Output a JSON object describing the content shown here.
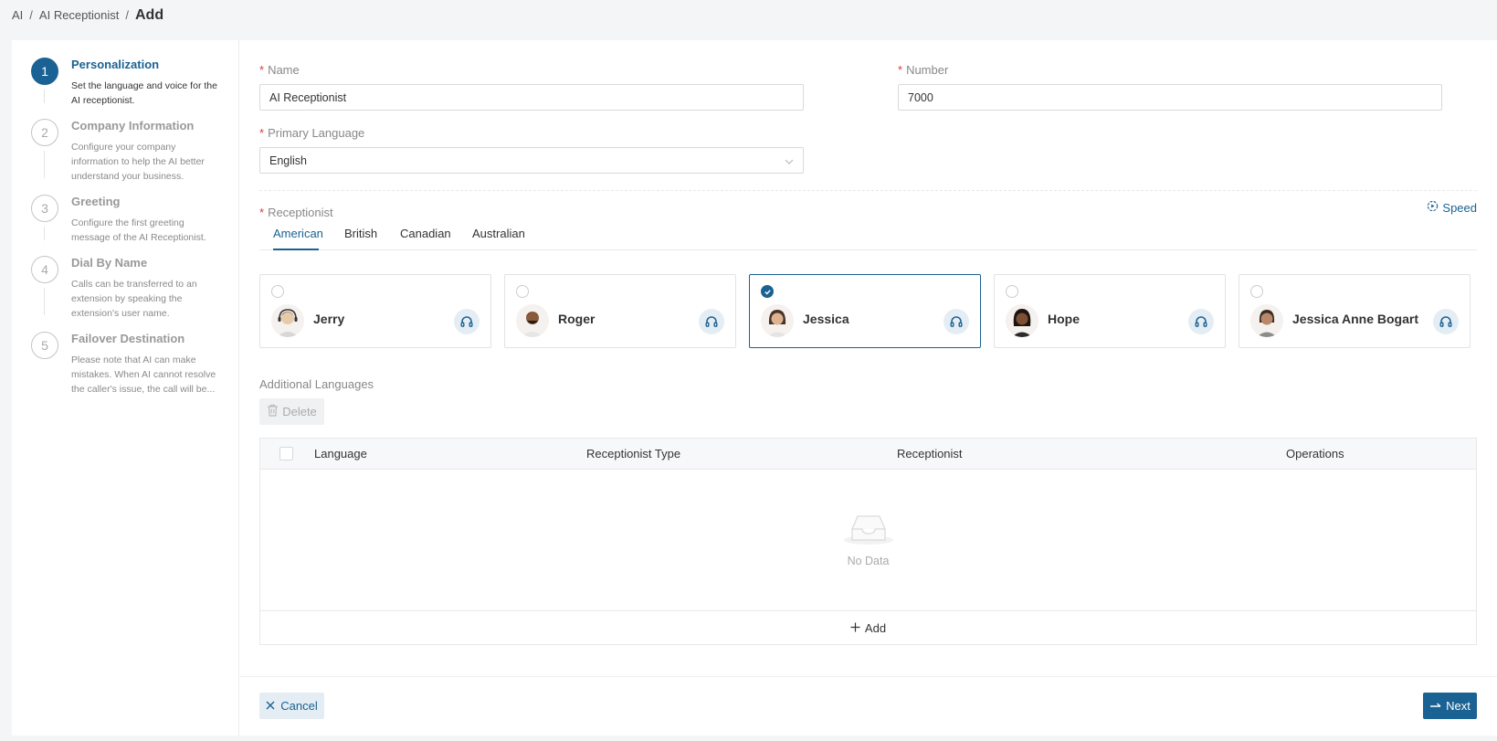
{
  "breadcrumb": {
    "items": [
      "AI",
      "AI Receptionist"
    ],
    "current": "Add"
  },
  "steps": [
    {
      "num": "1",
      "title": "Personalization",
      "desc": [
        "Set the language and voice for the",
        "AI receptionist."
      ]
    },
    {
      "num": "2",
      "title": "Company Information",
      "desc": [
        "Configure your company",
        "information to help the AI better",
        "understand your business."
      ]
    },
    {
      "num": "3",
      "title": "Greeting",
      "desc": [
        "Configure the first greeting",
        "message of the AI Receptionist."
      ]
    },
    {
      "num": "4",
      "title": "Dial By Name",
      "desc": [
        "Calls can be transferred to an",
        "extension by speaking the",
        "extension's user name."
      ]
    },
    {
      "num": "5",
      "title": "Failover Destination",
      "desc": [
        "Please note that AI can make",
        "mistakes. When AI cannot resolve",
        "the caller's issue, the call will be..."
      ]
    }
  ],
  "form": {
    "name_label": "Name",
    "name_value": "AI Receptionist",
    "number_label": "Number",
    "number_value": "7000",
    "language_label": "Primary Language",
    "language_value": "English",
    "receptionist_label": "Receptionist",
    "speed_label": "Speed"
  },
  "tabs": [
    "American",
    "British",
    "Canadian",
    "Australian"
  ],
  "active_tab": "American",
  "voices": [
    {
      "name": "Jerry",
      "selected": false
    },
    {
      "name": "Roger",
      "selected": false
    },
    {
      "name": "Jessica",
      "selected": true
    },
    {
      "name": "Hope",
      "selected": false
    },
    {
      "name": "Jessica Anne Bogart",
      "selected": false
    }
  ],
  "additional": {
    "label": "Additional Languages",
    "delete_label": "Delete",
    "columns": [
      "Language",
      "Receptionist Type",
      "Receptionist",
      "Operations"
    ],
    "empty_text": "No Data",
    "add_label": "Add"
  },
  "footer": {
    "cancel_label": "Cancel",
    "next_label": "Next"
  },
  "colors": {
    "primary": "#1a6293",
    "required": "#e53935"
  }
}
